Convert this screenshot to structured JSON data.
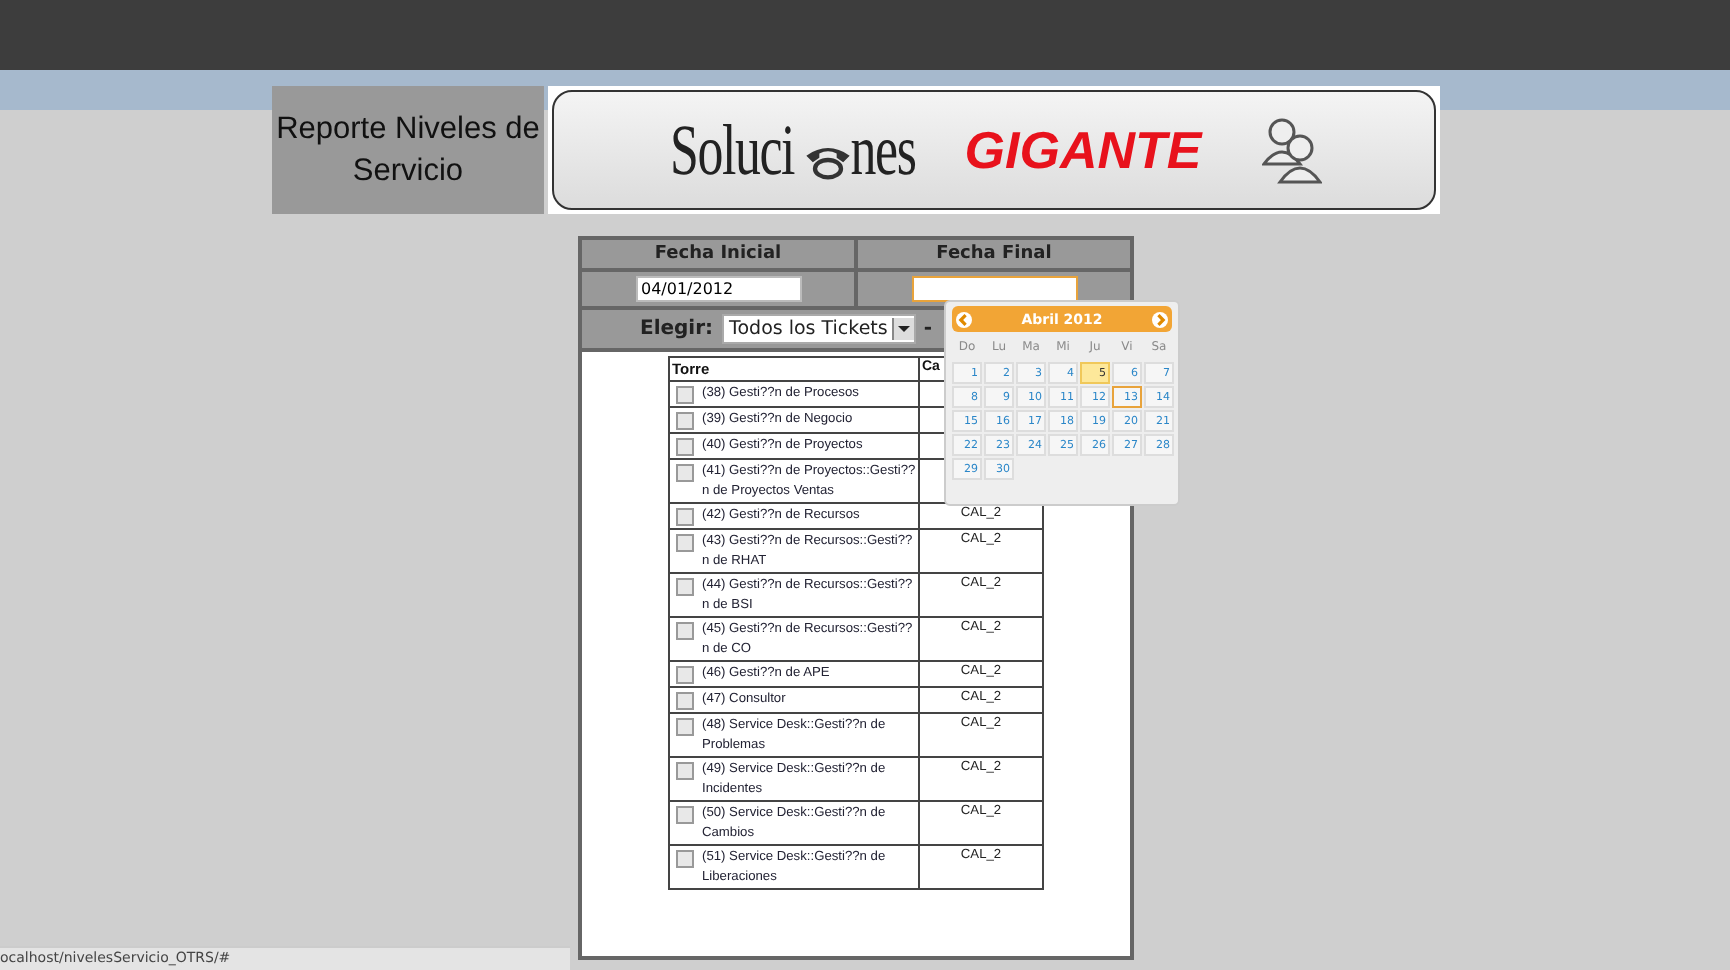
{
  "header": {
    "title": "Reporte Niveles de Servicio",
    "logo": {
      "word_left": "Soluci",
      "word_right": "nes",
      "brand": "GIGANTE"
    }
  },
  "form": {
    "columns": [
      "Fecha Inicial",
      "Fecha Final"
    ],
    "start_date": {
      "value": "04/01/2012"
    },
    "choose": {
      "label": "Elegir:",
      "value": "Todos los Tickets",
      "separator": "-"
    }
  },
  "towers": {
    "columns": [
      "Torre",
      "Ca"
    ],
    "rows": [
      {
        "name": "(38) Gesti??n de Procesos",
        "checked": false
      },
      {
        "name": "(39) Gesti??n de Negocio",
        "checked": false
      },
      {
        "name": "(40) Gesti??n de Proyectos",
        "checked": false
      },
      {
        "name": "(41) Gesti??n de Proyectos::Gesti??n de Proyectos Ventas",
        "checked": false
      },
      {
        "name": "(42) Gesti??n de Recursos",
        "checked": false,
        "value": "CAL_2"
      },
      {
        "name": "(43) Gesti??n de Recursos::Gesti??n de RHAT",
        "checked": false,
        "value": "CAL_2"
      },
      {
        "name": "(44) Gesti??n de Recursos::Gesti??n de BSI",
        "checked": false,
        "value": "CAL_2"
      },
      {
        "name": "(45) Gesti??n de Recursos::Gesti??n de CO",
        "checked": false,
        "value": "CAL_2"
      },
      {
        "name": "(46) Gesti??n de APE",
        "checked": false,
        "value": "CAL_2"
      },
      {
        "name": "(47) Consultor",
        "checked": false,
        "value": "CAL_2"
      },
      {
        "name": "(48) Service Desk::Gesti??n de Problemas",
        "checked": false,
        "value": "CAL_2"
      },
      {
        "name": "(49) Service Desk::Gesti??n de Incidentes",
        "checked": false,
        "value": "CAL_2"
      },
      {
        "name": "(50) Service Desk::Gesti??n de Cambios",
        "checked": false,
        "value": "CAL_2"
      },
      {
        "name": "(51) Service Desk::Gesti??n de Liberaciones",
        "checked": false,
        "value": "CAL_2"
      }
    ]
  },
  "calendar": {
    "month": "Abril 2012",
    "weekdays": [
      "Do",
      "Lu",
      "Ma",
      "Mi",
      "Ju",
      "Vi",
      "Sa"
    ],
    "days": [
      {
        "label": "1",
        "today": false,
        "selected": false
      },
      {
        "label": "2",
        "today": false,
        "selected": false
      },
      {
        "label": "3",
        "today": false,
        "selected": false
      },
      {
        "label": "4",
        "today": false,
        "selected": false
      },
      {
        "label": "5",
        "today": true,
        "selected": false
      },
      {
        "label": "6",
        "today": false,
        "selected": false
      },
      {
        "label": "7",
        "today": false,
        "selected": false
      },
      {
        "label": "8",
        "today": false,
        "selected": false
      },
      {
        "label": "9",
        "today": false,
        "selected": false
      },
      {
        "label": "10",
        "today": false,
        "selected": false
      },
      {
        "label": "11",
        "today": false,
        "selected": false
      },
      {
        "label": "12",
        "today": false,
        "selected": false
      },
      {
        "label": "13",
        "today": false,
        "selected": true
      },
      {
        "label": "14",
        "today": false,
        "selected": false
      },
      {
        "label": "15",
        "today": false,
        "selected": false
      },
      {
        "label": "16",
        "today": false,
        "selected": false
      },
      {
        "label": "17",
        "today": false,
        "selected": false
      },
      {
        "label": "18",
        "today": false,
        "selected": false
      },
      {
        "label": "19",
        "today": false,
        "selected": false
      },
      {
        "label": "20",
        "today": false,
        "selected": false
      },
      {
        "label": "21",
        "today": false,
        "selected": false
      },
      {
        "label": "22",
        "today": false,
        "selected": false
      },
      {
        "label": "23",
        "today": false,
        "selected": false
      },
      {
        "label": "24",
        "today": false,
        "selected": false
      },
      {
        "label": "25",
        "today": false,
        "selected": false
      },
      {
        "label": "26",
        "today": false,
        "selected": false
      },
      {
        "label": "27",
        "today": false,
        "selected": false
      },
      {
        "label": "28",
        "today": false,
        "selected": false
      },
      {
        "label": "29",
        "today": false,
        "selected": false
      },
      {
        "label": "30",
        "today": false,
        "selected": false
      }
    ]
  },
  "status_bar": {
    "url": "ocalhost/nivelesServicio_OTRS/#"
  }
}
